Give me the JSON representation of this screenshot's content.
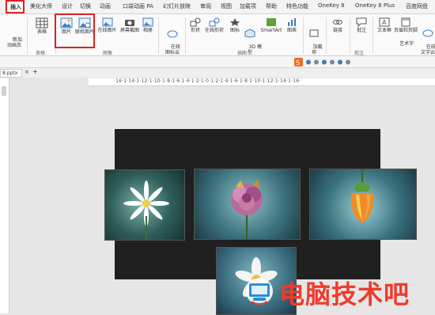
{
  "ribbon_tabs": [
    "插入",
    "美化大师",
    "设计",
    "切换",
    "动画",
    "口袋动画 PA",
    "幻灯片放映",
    "审阅",
    "视图",
    "加载项",
    "帮助",
    "特色功能",
    "OneKey 8",
    "OneKey 8 Plus",
    "百度网盘"
  ],
  "ribbon": {
    "new_slide": "新加\n动画页",
    "table": "表格",
    "picture": "图片",
    "online_picture": "联机图片",
    "online_picture2": "在线图片",
    "screenshot": "屏幕截图",
    "album": "相册",
    "online_icons": "在线\n图标云",
    "shapes": "形状",
    "online_shapes": "在线形状",
    "icons": "图标",
    "model3d": "3D 模\n型",
    "smartart": "SmartArt",
    "chart": "图表",
    "addins": "加载\n项",
    "link": "链接",
    "comment": "批注",
    "textbox": "文本框",
    "header_footer": "页眉和页脚",
    "wordart": "艺术字",
    "online_text": "在线\n文字云",
    "groups": {
      "slides": "表格",
      "images": "图像",
      "illustrations": "插图",
      "comments": "批注"
    }
  },
  "file_tab": "8.pptx",
  "ruler_text": "·16·1·14·1·12·1·10·1·8·1·6·1·4·1·2·1·0·1·2·1·4·1·6·1·8·1·10·1·12·1·14·1·16·",
  "watermark": {
    "text": "电脑技术吧",
    "color": "#f03a2a"
  },
  "colors": {
    "highlight": "#e02020",
    "slide_bg": "#202020"
  }
}
